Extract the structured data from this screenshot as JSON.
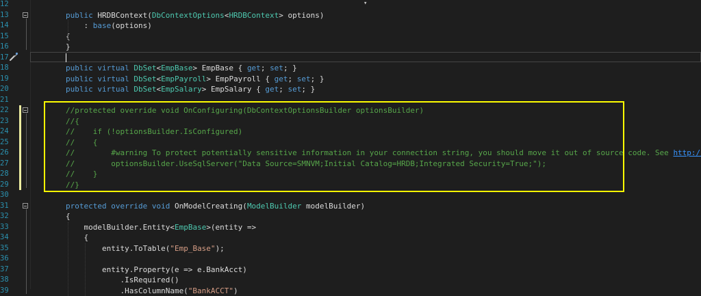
{
  "editor": {
    "lines": [
      {
        "n": "12",
        "tokens": []
      },
      {
        "n": "13",
        "tokens": [
          {
            "t": "public ",
            "c": "kw"
          },
          {
            "t": "HRDBContext(",
            "c": ""
          },
          {
            "t": "DbContextOptions",
            "c": "ty"
          },
          {
            "t": "<",
            "c": ""
          },
          {
            "t": "HRDBContext",
            "c": "ty"
          },
          {
            "t": "> options)",
            "c": ""
          }
        ]
      },
      {
        "n": "14",
        "tokens": [
          {
            "t": "    : ",
            "c": ""
          },
          {
            "t": "base",
            "c": "kw"
          },
          {
            "t": "(options)",
            "c": ""
          }
        ]
      },
      {
        "n": "15",
        "tokens": [
          {
            "t": "{",
            "c": ""
          }
        ]
      },
      {
        "n": "16",
        "tokens": [
          {
            "t": "}",
            "c": ""
          }
        ]
      },
      {
        "n": "17",
        "tokens": []
      },
      {
        "n": "18",
        "tokens": [
          {
            "t": "public ",
            "c": "kw"
          },
          {
            "t": "virtual ",
            "c": "kw"
          },
          {
            "t": "DbSet",
            "c": "ty"
          },
          {
            "t": "<",
            "c": ""
          },
          {
            "t": "EmpBase",
            "c": "ty"
          },
          {
            "t": "> EmpBase { ",
            "c": ""
          },
          {
            "t": "get",
            "c": "kw"
          },
          {
            "t": "; ",
            "c": ""
          },
          {
            "t": "set",
            "c": "kw"
          },
          {
            "t": "; }",
            "c": ""
          }
        ]
      },
      {
        "n": "19",
        "tokens": [
          {
            "t": "public ",
            "c": "kw"
          },
          {
            "t": "virtual ",
            "c": "kw"
          },
          {
            "t": "DbSet",
            "c": "ty"
          },
          {
            "t": "<",
            "c": ""
          },
          {
            "t": "EmpPayroll",
            "c": "ty"
          },
          {
            "t": "> EmpPayroll { ",
            "c": ""
          },
          {
            "t": "get",
            "c": "kw"
          },
          {
            "t": "; ",
            "c": ""
          },
          {
            "t": "set",
            "c": "kw"
          },
          {
            "t": "; }",
            "c": ""
          }
        ]
      },
      {
        "n": "20",
        "tokens": [
          {
            "t": "public ",
            "c": "kw"
          },
          {
            "t": "virtual ",
            "c": "kw"
          },
          {
            "t": "DbSet",
            "c": "ty"
          },
          {
            "t": "<",
            "c": ""
          },
          {
            "t": "EmpSalary",
            "c": "ty"
          },
          {
            "t": "> EmpSalary { ",
            "c": ""
          },
          {
            "t": "get",
            "c": "kw"
          },
          {
            "t": "; ",
            "c": ""
          },
          {
            "t": "set",
            "c": "kw"
          },
          {
            "t": "; }",
            "c": ""
          }
        ]
      },
      {
        "n": "21",
        "tokens": []
      },
      {
        "n": "22",
        "tokens": [
          {
            "t": "//protected override void OnConfiguring(DbContextOptionsBuilder optionsBuilder)",
            "c": "cm"
          }
        ]
      },
      {
        "n": "23",
        "tokens": [
          {
            "t": "//{",
            "c": "cm"
          }
        ]
      },
      {
        "n": "24",
        "tokens": [
          {
            "t": "//    if (!optionsBuilder.IsConfigured)",
            "c": "cm"
          }
        ]
      },
      {
        "n": "25",
        "tokens": [
          {
            "t": "//    {",
            "c": "cm"
          }
        ]
      },
      {
        "n": "26",
        "tokens": [
          {
            "t": "//        #warning To protect potentially sensitive information in your connection string, you should move it out of source code. See ",
            "c": "cm"
          },
          {
            "t": "http://go.mic",
            "c": "link"
          }
        ]
      },
      {
        "n": "27",
        "tokens": [
          {
            "t": "//        optionsBuilder.UseSqlServer(\"Data Source=SMNVM;Initial Catalog=HRDB;Integrated Security=True;\");",
            "c": "cm"
          }
        ]
      },
      {
        "n": "28",
        "tokens": [
          {
            "t": "//    }",
            "c": "cm"
          }
        ]
      },
      {
        "n": "29",
        "tokens": [
          {
            "t": "//}",
            "c": "cm"
          }
        ]
      },
      {
        "n": "30",
        "tokens": []
      },
      {
        "n": "31",
        "tokens": [
          {
            "t": "protected ",
            "c": "kw"
          },
          {
            "t": "override ",
            "c": "kw"
          },
          {
            "t": "void ",
            "c": "kw"
          },
          {
            "t": "OnModelCreating(",
            "c": ""
          },
          {
            "t": "ModelBuilder",
            "c": "ty"
          },
          {
            "t": " modelBuilder)",
            "c": ""
          }
        ]
      },
      {
        "n": "32",
        "tokens": [
          {
            "t": "{",
            "c": ""
          }
        ]
      },
      {
        "n": "33",
        "tokens": [
          {
            "t": "    modelBuilder.Entity<",
            "c": ""
          },
          {
            "t": "EmpBase",
            "c": "ty"
          },
          {
            "t": ">(entity =>",
            "c": ""
          }
        ]
      },
      {
        "n": "34",
        "tokens": [
          {
            "t": "    {",
            "c": ""
          }
        ]
      },
      {
        "n": "35",
        "tokens": [
          {
            "t": "        entity.ToTable(",
            "c": ""
          },
          {
            "t": "\"Emp_Base\"",
            "c": "st"
          },
          {
            "t": ");",
            "c": ""
          }
        ]
      },
      {
        "n": "36",
        "tokens": []
      },
      {
        "n": "37",
        "tokens": [
          {
            "t": "        entity.Property(e => e.BankAcct)",
            "c": ""
          }
        ]
      },
      {
        "n": "38",
        "tokens": [
          {
            "t": "            .IsRequired()",
            "c": ""
          }
        ]
      },
      {
        "n": "39",
        "tokens": [
          {
            "t": "            .HasColumnName(",
            "c": ""
          },
          {
            "t": "\"BankACCT\"",
            "c": "st"
          },
          {
            "t": ")",
            "c": ""
          }
        ]
      }
    ]
  },
  "colors": {
    "background": "#1e1e1e",
    "keyword": "#569cd6",
    "type": "#4ec9b0",
    "comment": "#57a64a",
    "string": "#d69d85",
    "line_number": "#2b91af",
    "highlight_box": "#ffff00"
  },
  "icons": {
    "quick_action": "screwdriver-icon",
    "fold": "collapse-toggle-icon"
  }
}
